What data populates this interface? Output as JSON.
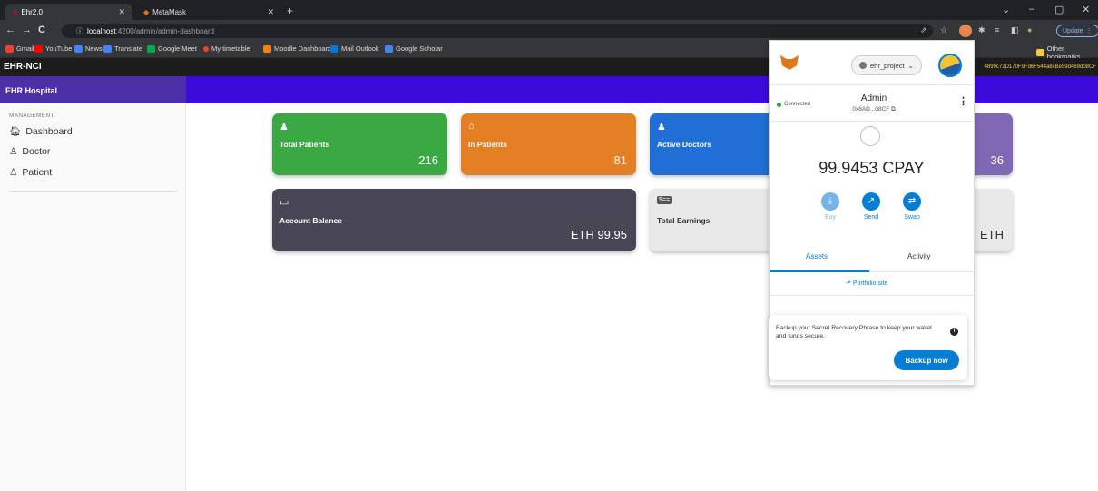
{
  "browser": {
    "tabs": [
      {
        "title": "Ehr2.0",
        "icon": "angular-icon"
      },
      {
        "title": "MetaMask",
        "icon": "metamask-fox-icon"
      }
    ],
    "new_tab": "+",
    "window_controls": {
      "dropdown": "⌄",
      "minimize": "–",
      "maximize": "▢",
      "close": "✕"
    },
    "url_host": "localhost",
    "url_path": ":4200/admin/admin-dashboard",
    "update_label": "Update",
    "bookmarks": [
      {
        "label": "Gmail",
        "color": "#ea4335"
      },
      {
        "label": "YouTube",
        "color": "#ff0000"
      },
      {
        "label": "News",
        "color": "#4285f4"
      },
      {
        "label": "Translate",
        "color": "#4285f4"
      },
      {
        "label": "Google Meet",
        "color": "#00ac47"
      },
      {
        "label": "My timetable",
        "color": "#ea4335"
      },
      {
        "label": "Moodle Dashboard",
        "color": "#f98012"
      },
      {
        "label": "Mail Outlook",
        "color": "#0078d4"
      },
      {
        "label": "Google Scholar",
        "color": "#4285f4"
      }
    ],
    "other_bookmarks": "Other bookmarks"
  },
  "app": {
    "title": "EHR-NCI",
    "hash": "4899c72D170F9Fd6F544a8cBe59d469d08CF",
    "brand": "EHR Hospital",
    "sidebar": {
      "caption": "MANAGEMENT",
      "items": [
        {
          "label": "Dashboard",
          "icon": "home-icon"
        },
        {
          "label": "Doctor",
          "icon": "doctor-icon"
        },
        {
          "label": "Patient",
          "icon": "patient-icon"
        }
      ]
    },
    "cards": [
      {
        "label": "Total Patients",
        "value": "216",
        "color": "#3aa843"
      },
      {
        "label": "In Patients",
        "value": "81",
        "color": "#e47f24"
      },
      {
        "label": "Active Doctors",
        "value": "",
        "color": "#1f6fd6"
      },
      {
        "label": "",
        "value": "36",
        "color": "#8068b5"
      },
      {
        "label": "Account Balance",
        "value": "ETH 99.95",
        "color": "#484554"
      },
      {
        "label": "Total Earnings",
        "value": "ETH",
        "color": "#e9e9e9"
      }
    ]
  },
  "metamask": {
    "network": "ehr_project",
    "connected": "Connected",
    "account_name": "Admin",
    "account_address": "0x8AD...08CF",
    "balance": "99.9453 CPAY",
    "actions": [
      {
        "label": "Buy",
        "color": "#74b4e9"
      },
      {
        "label": "Send",
        "color": "#037dd6"
      },
      {
        "label": "Swap",
        "color": "#037dd6"
      }
    ],
    "tabs": [
      "Assets",
      "Activity"
    ],
    "portfolio": "Portfolio site",
    "backup_text": "Backup your Secret Recovery Phrase to keep your wallet and funds secure.",
    "backup_button": "Backup now"
  }
}
